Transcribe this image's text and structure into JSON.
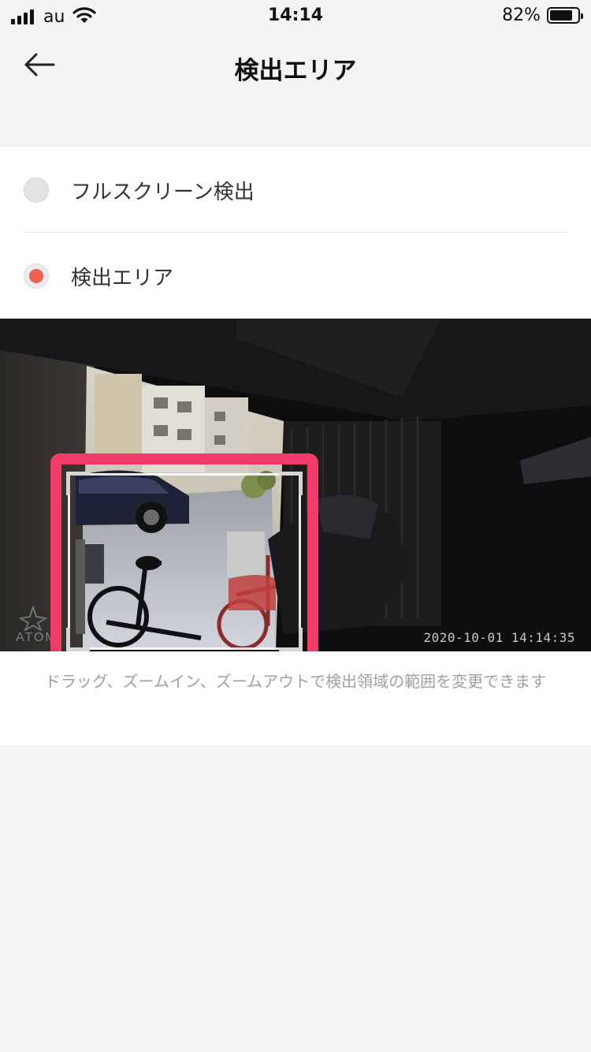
{
  "status_bar": {
    "carrier": "au",
    "time": "14:14",
    "battery_percent": "82%",
    "battery_level": 0.82
  },
  "nav": {
    "title": "検出エリア",
    "back_icon": "arrow-left-icon"
  },
  "options": [
    {
      "label": "フルスクリーン検出",
      "selected": false
    },
    {
      "label": "検出エリア",
      "selected": true
    }
  ],
  "camera": {
    "timestamp": "2020-10-01  14:14:35",
    "logo_text": "ATOM"
  },
  "instruction": "ドラッグ、ズームイン、ズームアウトで検出領域の範囲を変更できます",
  "colors": {
    "accent_radio": "#ee6150",
    "highlight": "#f03b6b",
    "background": "#f4f4f4"
  }
}
